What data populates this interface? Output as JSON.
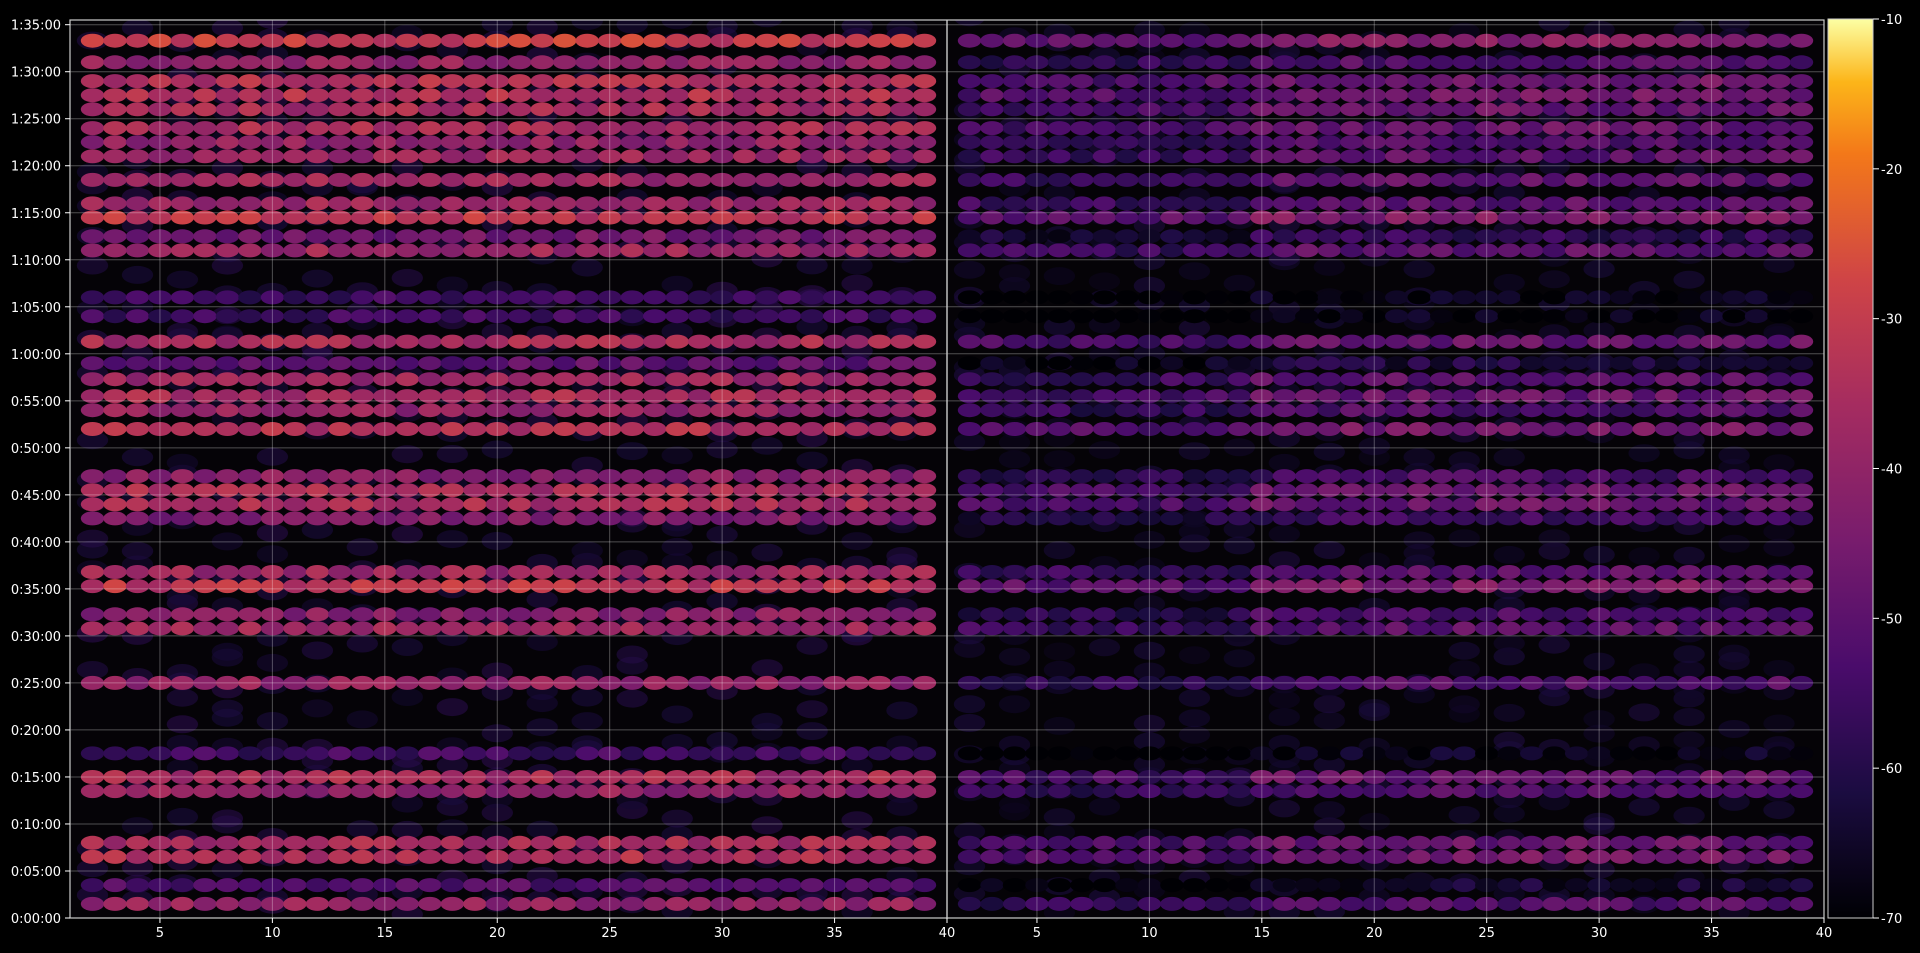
{
  "chart_data": {
    "type": "heatmap",
    "title": "",
    "xlabel": "",
    "ylabel": "",
    "y_unit": "elapsed time (h:mm:ss)",
    "y_ticks": [
      "0:00:00",
      "0:05:00",
      "0:10:00",
      "0:15:00",
      "0:20:00",
      "0:25:00",
      "0:30:00",
      "0:35:00",
      "0:40:00",
      "0:45:00",
      "0:50:00",
      "0:55:00",
      "1:00:00",
      "1:05:00",
      "1:10:00",
      "1:15:00",
      "1:20:00",
      "1:25:00",
      "1:30:00",
      "1:35:00"
    ],
    "ylim_minutes": [
      0,
      95.5
    ],
    "colorbar": {
      "colormap": "inferno",
      "range": [
        -70,
        -10
      ],
      "ticks": [
        "-10",
        "-20",
        "-30",
        "-40",
        "-50",
        "-60",
        "-70"
      ],
      "tick_values": [
        -10,
        -20,
        -30,
        -40,
        -50,
        -60,
        -70
      ]
    },
    "grid": true,
    "panels": [
      {
        "name": "left",
        "xlim": [
          1,
          40
        ],
        "x_ticks": [
          "5",
          "10",
          "15",
          "20",
          "25",
          "30",
          "35",
          "40"
        ],
        "x_tick_values": [
          5,
          10,
          15,
          20,
          25,
          30,
          35,
          40
        ],
        "columns": [
          2,
          39
        ],
        "level_offset": 0
      },
      {
        "name": "right",
        "xlim": [
          1,
          40
        ],
        "x_ticks": [
          "5",
          "10",
          "15",
          "20",
          "25",
          "30",
          "35",
          "40"
        ],
        "x_tick_values": [
          5,
          10,
          15,
          20,
          25,
          30,
          35,
          40
        ],
        "columns": [
          2,
          39
        ],
        "level_offset": -12
      }
    ],
    "bands": [
      {
        "t": 1.5,
        "level": -40
      },
      {
        "t": 3.5,
        "level": -52
      },
      {
        "t": 6.5,
        "level": -34
      },
      {
        "t": 8.0,
        "level": -36
      },
      {
        "t": 13.5,
        "level": -40
      },
      {
        "t": 15.0,
        "level": -36
      },
      {
        "t": 17.5,
        "level": -55
      },
      {
        "t": 25.0,
        "level": -40
      },
      {
        "t": 30.8,
        "level": -38
      },
      {
        "t": 32.3,
        "level": -42
      },
      {
        "t": 35.3,
        "level": -32
      },
      {
        "t": 36.8,
        "level": -38
      },
      {
        "t": 42.5,
        "level": -44
      },
      {
        "t": 44.0,
        "level": -36
      },
      {
        "t": 45.5,
        "level": -36
      },
      {
        "t": 47.0,
        "level": -42
      },
      {
        "t": 52.0,
        "level": -34
      },
      {
        "t": 54.0,
        "level": -40
      },
      {
        "t": 55.5,
        "level": -36
      },
      {
        "t": 57.3,
        "level": -38
      },
      {
        "t": 59.0,
        "level": -50
      },
      {
        "t": 61.3,
        "level": -36
      },
      {
        "t": 64.0,
        "level": -56
      },
      {
        "t": 66.0,
        "level": -56
      },
      {
        "t": 71.0,
        "level": -38
      },
      {
        "t": 72.5,
        "level": -46
      },
      {
        "t": 74.5,
        "level": -32
      },
      {
        "t": 76.0,
        "level": -38
      },
      {
        "t": 78.5,
        "level": -38
      },
      {
        "t": 81.0,
        "level": -38
      },
      {
        "t": 82.5,
        "level": -40
      },
      {
        "t": 84.0,
        "level": -36
      },
      {
        "t": 86.0,
        "level": -36
      },
      {
        "t": 87.5,
        "level": -34
      },
      {
        "t": 89.0,
        "level": -34
      },
      {
        "t": 91.0,
        "level": -40
      },
      {
        "t": 93.3,
        "level": -30
      }
    ]
  }
}
